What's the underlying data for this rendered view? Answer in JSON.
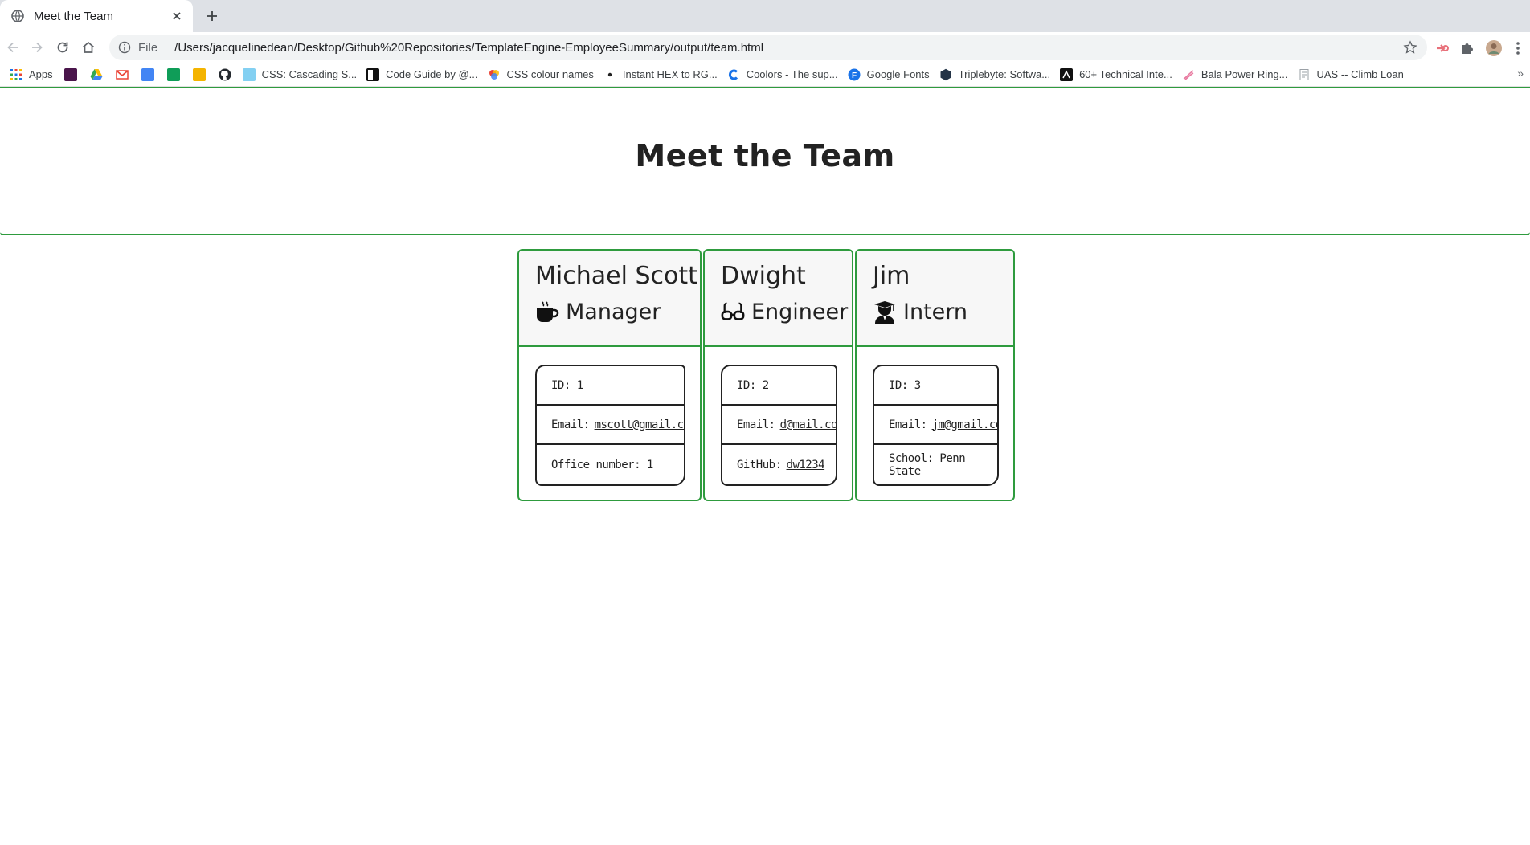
{
  "browser": {
    "tab_title": "Meet the Team",
    "address_scheme": "File",
    "address_url": "/Users/jacquelinedean/Desktop/Github%20Repositories/TemplateEngine-EmployeeSummary/output/team.html",
    "bookmarks": [
      {
        "label": "Apps",
        "icon": "apps-grid-icon"
      },
      {
        "label": "",
        "icon": "slack-icon"
      },
      {
        "label": "",
        "icon": "drive-icon"
      },
      {
        "label": "",
        "icon": "gmail-icon"
      },
      {
        "label": "",
        "icon": "docs-icon"
      },
      {
        "label": "",
        "icon": "sheets-icon"
      },
      {
        "label": "",
        "icon": "slides-icon"
      },
      {
        "label": "",
        "icon": "github-icon"
      },
      {
        "label": "CSS: Cascading S...",
        "icon": "mdn-icon"
      },
      {
        "label": "Code Guide by @...",
        "icon": "code-guide-icon"
      },
      {
        "label": "CSS colour names",
        "icon": "colour-icon"
      },
      {
        "label": "Instant HEX to RG...",
        "icon": "dot-icon"
      },
      {
        "label": "Coolors - The sup...",
        "icon": "coolors-icon"
      },
      {
        "label": "Google Fonts",
        "icon": "google-fonts-icon"
      },
      {
        "label": "Triplebyte: Softwa...",
        "icon": "triplebyte-icon"
      },
      {
        "label": "60+ Technical Inte...",
        "icon": "technical-icon"
      },
      {
        "label": "Bala Power Ring...",
        "icon": "bala-icon"
      },
      {
        "label": "UAS -- Climb Loan",
        "icon": "doc-icon"
      }
    ],
    "bookmarks_overflow": "»"
  },
  "page": {
    "title": "Meet the Team",
    "employees": [
      {
        "name": "Michael Scott",
        "role": "Manager",
        "role_icon": "coffee-mug-icon",
        "id_label": "ID: 1",
        "email_label": "Email:",
        "email": "mscott@gmail.com",
        "extra_label": "Office number: 1",
        "extra_link": ""
      },
      {
        "name": "Dwight",
        "role": "Engineer",
        "role_icon": "glasses-icon",
        "id_label": "ID: 2",
        "email_label": "Email:",
        "email": "d@mail.com",
        "extra_label": "GitHub:",
        "extra_link": "dw1234"
      },
      {
        "name": "Jim",
        "role": "Intern",
        "role_icon": "graduate-icon",
        "id_label": "ID: 3",
        "email_label": "Email:",
        "email": "jm@gmail.com",
        "extra_label": "School: Penn State",
        "extra_link": ""
      }
    ]
  },
  "colors": {
    "accent_green": "#2e9b3e",
    "header_bg": "#f7f7f7",
    "text_dark": "#222222"
  }
}
